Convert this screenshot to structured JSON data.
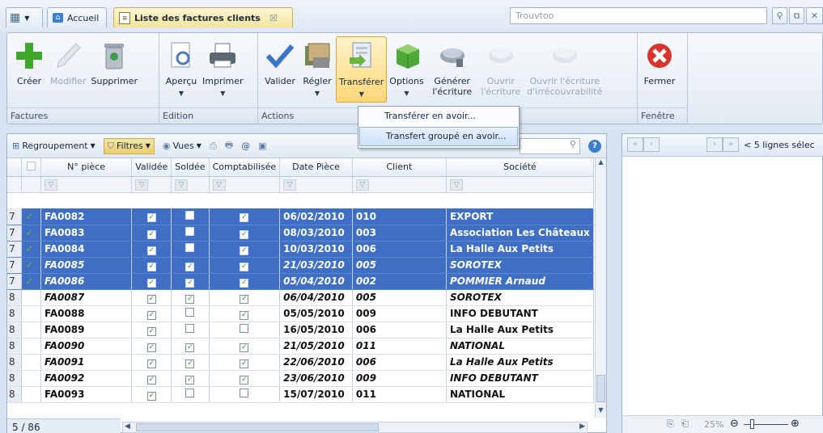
{
  "tabs": {
    "home_label": "Accueil",
    "active_label": "Liste des factures clients"
  },
  "search": {
    "placeholder": "Trouvtoo"
  },
  "ribbon": {
    "groups": [
      {
        "label": "Factures",
        "buttons": [
          {
            "label": "Créer",
            "icon": "plus-icon",
            "enabled": true
          },
          {
            "label": "Modifier",
            "icon": "pencil-icon",
            "enabled": false
          },
          {
            "label": "Supprimer",
            "icon": "trash-icon",
            "enabled": true
          }
        ]
      },
      {
        "label": "Edition",
        "buttons": [
          {
            "label": "Aperçu",
            "icon": "preview-icon",
            "enabled": true
          },
          {
            "label": "Imprimer",
            "icon": "printer-icon",
            "enabled": true
          }
        ]
      },
      {
        "label": "Actions",
        "buttons": [
          {
            "label": "Valider",
            "icon": "checkmark-icon",
            "enabled": true
          },
          {
            "label": "Régler",
            "icon": "money-icon",
            "enabled": true
          },
          {
            "label": "Transférer",
            "icon": "transfer-icon",
            "enabled": true
          },
          {
            "label": "Options",
            "icon": "box-icon",
            "enabled": true
          },
          {
            "label": "Générer l'écriture",
            "icon": "generate-entry-icon",
            "enabled": true
          },
          {
            "label": "Ouvrir l'écriture",
            "icon": "open-entry-icon",
            "enabled": false
          },
          {
            "label": "Ouvrir l'écriture d'irrécouvrabilité",
            "icon": "open-bad-debt-icon",
            "enabled": false
          }
        ]
      },
      {
        "label": "Fenêtre",
        "buttons": [
          {
            "label": "Fermer",
            "icon": "close-red-icon",
            "enabled": true
          }
        ]
      }
    ]
  },
  "dropdown": {
    "items": [
      "Transférer en avoir...",
      "Transfert groupé en avoir..."
    ],
    "selected_index": 1
  },
  "grid_toolbar": {
    "grouping": "Regroupement",
    "filters": "Filtres",
    "views": "Vues"
  },
  "grid": {
    "columns": [
      "N° pièce",
      "Validée",
      "Soldée",
      "Comptabilisée",
      "Date Pièce",
      "Client",
      "Société"
    ],
    "rows": [
      {
        "num": "7",
        "piece": "FA0082",
        "validee": true,
        "soldee": false,
        "compta": true,
        "date": "06/02/2010",
        "client": "010",
        "societe": "EXPORT",
        "selected": true,
        "italic": false
      },
      {
        "num": "7",
        "piece": "FA0083",
        "validee": true,
        "soldee": false,
        "compta": true,
        "date": "08/03/2010",
        "client": "003",
        "societe": "Association Les Châteaux",
        "selected": true,
        "italic": false
      },
      {
        "num": "7",
        "piece": "FA0084",
        "validee": true,
        "soldee": false,
        "compta": true,
        "date": "10/03/2010",
        "client": "006",
        "societe": "La Halle Aux Petits",
        "selected": true,
        "italic": false
      },
      {
        "num": "7",
        "piece": "FA0085",
        "validee": true,
        "soldee": true,
        "compta": true,
        "date": "21/03/2010",
        "client": "005",
        "societe": "SOROTEX",
        "selected": true,
        "italic": true
      },
      {
        "num": "7",
        "piece": "FA0086",
        "validee": true,
        "soldee": true,
        "compta": true,
        "date": "05/04/2010",
        "client": "002",
        "societe": "POMMIER Arnaud",
        "selected": true,
        "italic": true
      },
      {
        "num": "8",
        "piece": "FA0087",
        "validee": true,
        "soldee": true,
        "compta": true,
        "date": "06/04/2010",
        "client": "005",
        "societe": "SOROTEX",
        "selected": false,
        "italic": true
      },
      {
        "num": "8",
        "piece": "FA0088",
        "validee": true,
        "soldee": false,
        "compta": true,
        "date": "05/05/2010",
        "client": "009",
        "societe": "INFO DEBUTANT",
        "selected": false,
        "italic": false
      },
      {
        "num": "8",
        "piece": "FA0089",
        "validee": true,
        "soldee": false,
        "compta": false,
        "date": "16/05/2010",
        "client": "006",
        "societe": "La Halle Aux Petits",
        "selected": false,
        "italic": false
      },
      {
        "num": "8",
        "piece": "FA0090",
        "validee": true,
        "soldee": true,
        "compta": true,
        "date": "21/05/2010",
        "client": "011",
        "societe": "NATIONAL",
        "selected": false,
        "italic": true
      },
      {
        "num": "8",
        "piece": "FA0091",
        "validee": true,
        "soldee": true,
        "compta": true,
        "date": "22/06/2010",
        "client": "006",
        "societe": "La Halle Aux Petits",
        "selected": false,
        "italic": true
      },
      {
        "num": "8",
        "piece": "FA0092",
        "validee": true,
        "soldee": true,
        "compta": true,
        "date": "23/06/2010",
        "client": "009",
        "societe": "INFO DEBUTANT",
        "selected": false,
        "italic": true
      },
      {
        "num": "8",
        "piece": "FA0093",
        "validee": true,
        "soldee": false,
        "compta": false,
        "date": "15/07/2010",
        "client": "011",
        "societe": "NATIONAL",
        "selected": false,
        "italic": false
      }
    ]
  },
  "status": {
    "count": "5 / 86"
  },
  "right_panel": {
    "lines_label": "< 5 lignes sélec",
    "zoom": "25%"
  },
  "colors": {
    "selection": "#3e6fc4",
    "accent_tab": "#f5e49a"
  }
}
